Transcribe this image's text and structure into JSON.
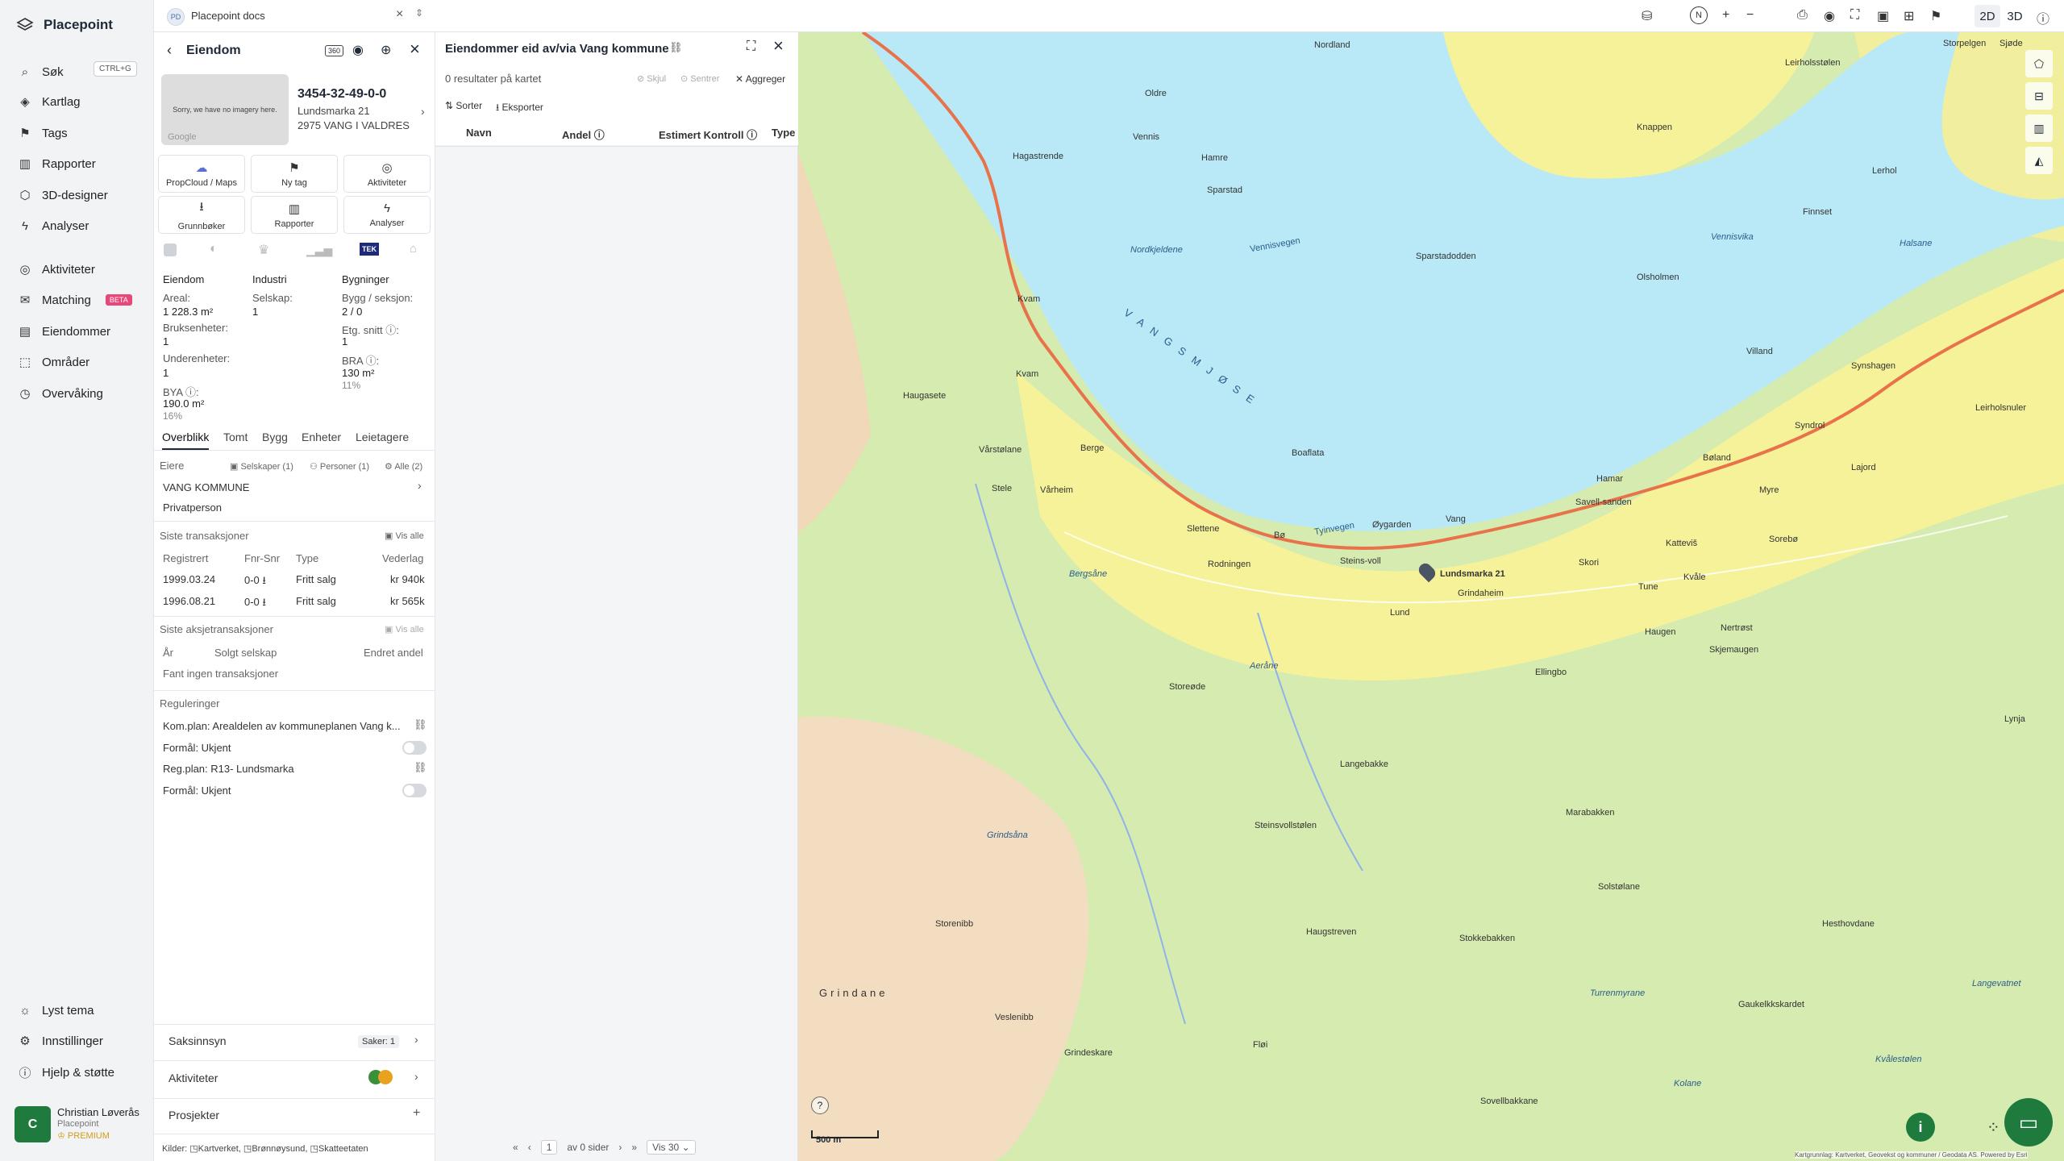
{
  "app": {
    "name": "Placepoint",
    "doc_tab": "Placepoint docs",
    "doc_chip": "PD"
  },
  "sidebar": {
    "search": {
      "label": "Søk",
      "shortcut": "CTRL+G"
    },
    "items": [
      {
        "label": "Kartlag"
      },
      {
        "label": "Tags"
      },
      {
        "label": "Rapporter"
      },
      {
        "label": "3D-designer"
      },
      {
        "label": "Analyser"
      },
      {
        "label": "Aktiviteter"
      },
      {
        "label": "Matching",
        "badge": "BETA"
      },
      {
        "label": "Eiendommer"
      },
      {
        "label": "Områder"
      },
      {
        "label": "Overvåking"
      }
    ],
    "bottom": [
      {
        "label": "Lyst tema"
      },
      {
        "label": "Innstillinger"
      },
      {
        "label": "Hjelp & støtte"
      }
    ],
    "user": {
      "initial": "C",
      "name": "Christian Løverås",
      "org": "Placepoint",
      "plan": "PREMIUM"
    }
  },
  "property": {
    "header": "Eiendom",
    "thumb_text": "Sorry, we have no imagery here.",
    "thumb_brand": "Google",
    "id": "3454-32-49-0-0",
    "address1": "Lundsmarka 21",
    "address2": "2975 VANG I VALDRES",
    "actions": [
      "PropCloud / Maps",
      "Ny tag",
      "Aktiviteter",
      "Grunnbøker",
      "Rapporter",
      "Analyser"
    ],
    "source_badge": "TEK",
    "stats": {
      "col1_title": "Eiendom",
      "col2_title": "Industri",
      "col3_title": "Bygninger",
      "areal_label": "Areal:",
      "areal": "1 228.3 m²",
      "selskap_label": "Selskap:",
      "selskap": "1",
      "bygg_label": "Bygg / seksjon:",
      "bygg": "2 / 0",
      "bruks_label": "Bruksenheter:",
      "bruks": "1",
      "etg_label": "Etg. snitt ⓘ:",
      "etg": "1",
      "under_label": "Underenheter:",
      "under": "1",
      "bra_label": "BRA ⓘ:",
      "bra": "130 m²",
      "bra_pct": "11%",
      "bya_label": "BYA ⓘ:",
      "bya": "190.0 m²",
      "bya_pct": "16%"
    },
    "tabs": [
      "Overblikk",
      "Tomt",
      "Bygg",
      "Enheter",
      "Leietagere"
    ],
    "owners": {
      "title": "Eiere",
      "filter1": "Selskaper (1)",
      "filter2": "Personer (1)",
      "filter3": "Alle (2)",
      "owner": "VANG KOMMUNE",
      "type": "Privatperson"
    },
    "transactions": {
      "title": "Siste transaksjoner",
      "see_all": "Vis alle",
      "headers": [
        "Registrert",
        "Fnr-Snr",
        "Type",
        "Vederlag"
      ],
      "rows": [
        {
          "date": "1999.03.24",
          "fnr": "0-0 ⭳",
          "type": "Fritt salg",
          "amount": "kr 940k"
        },
        {
          "date": "1996.08.21",
          "fnr": "0-0 ⭳",
          "type": "Fritt salg",
          "amount": "kr 565k"
        }
      ]
    },
    "shares": {
      "title": "Siste aksjetransaksjoner",
      "see_all": "Vis alle",
      "headers": [
        "År",
        "Solgt selskap",
        "Endret andel"
      ],
      "empty": "Fant ingen transaksjoner"
    },
    "regulations": {
      "title": "Reguleringer",
      "r1": "Kom.plan: Arealdelen av kommuneplanen Vang k...",
      "r1_purpose": "Formål: Ukjent",
      "r2": "Reg.plan: R13- Lundsmarka",
      "r2_purpose": "Formål: Ukjent"
    },
    "footer_rows": [
      {
        "label": "Saksinnsyn",
        "meta": "Saker: 1"
      },
      {
        "label": "Aktiviteter"
      },
      {
        "label": "Prosjekter"
      }
    ],
    "sources": {
      "label": "Kilder:",
      "s1": "Kartverket,",
      "s2": "Brønnøysund,",
      "s3": "Skatteetaten"
    }
  },
  "results": {
    "title": "Eiendommer eid av/via Vang kommune",
    "count": "0 resultater på kartet",
    "hide": "Skjul",
    "center": "Sentrer",
    "aggregate": "Aggreger",
    "sort": "Sorter",
    "export": "Eksporter",
    "columns": [
      "Navn",
      "Andel ⓘ",
      "Estimert Kontroll ⓘ",
      "Type"
    ],
    "pager": {
      "page": "1",
      "of_pages": "av 0 sider",
      "per_page": "Vis 30"
    }
  },
  "map": {
    "toggle_2d": "2D",
    "toggle_3d": "3D",
    "lake_label": "V A N G S M J Ø S E",
    "places": [
      "Nordland",
      "Oldre",
      "Vennis",
      "Hamre",
      "Sparstad",
      "Kvam",
      "Haugasete",
      "Kvam",
      "Berge",
      "Vårstølane",
      "Vårheim",
      "Stele",
      "Boaflata",
      "Slettene",
      "Rodningen",
      "Bø",
      "Steins-voll",
      "Øygarden",
      "Vang",
      "Grindaheim",
      "Lund",
      "Skori",
      "Tune",
      "Kvåle",
      "Haugen",
      "Nertrøst",
      "Skjemaugen",
      "Ellingbo",
      "Hamar",
      "Savell-sanden",
      "Bøland",
      "Myre",
      "Sorebø",
      "Katteviš",
      "Syndrol",
      "Lajord",
      "Synshagen",
      "Villand",
      "Olsholmen",
      "Sparstadodden",
      "Hagastrende",
      "Nordkjeldene",
      "Leirholsstølen",
      "Knappen",
      "Lerhol",
      "Finnset",
      "Vennisvika",
      "Halsane",
      "Langebakke",
      "Steinsvollstølen",
      "Marabakken",
      "Solstølane",
      "Storenibb",
      "Veslenibb",
      "Grindeskare",
      "Grindane",
      "Fløi",
      "Hesthovdane",
      "Lynja",
      "Stokkebakken",
      "Sovellbakkane",
      "Gaukelkkskardet",
      "Langevatnet",
      "Kvålestølen",
      "Kolane",
      "Turrenmyrane",
      "Bergsåne",
      "Aeråne",
      "Grindsåna",
      "Storeøde",
      "Haugstreven",
      "Leirholsnuler",
      "Storpelgen",
      "Sjøde"
    ],
    "road_label": "Tyinvegen",
    "road_label2": "Vennisvegen",
    "scale": "500 m",
    "attribution": "Kartgrunnlag: Kartverket, Geovekst og kommuner / Geodata AS. Powered by Esri",
    "marker_label": "Lundsmarka 21",
    "colors": {
      "water": "#b9e9f7",
      "forest": "#d6ebb0",
      "field": "#f6f29a",
      "mountain": "#f3ddc0",
      "road": "#e8734a"
    }
  }
}
